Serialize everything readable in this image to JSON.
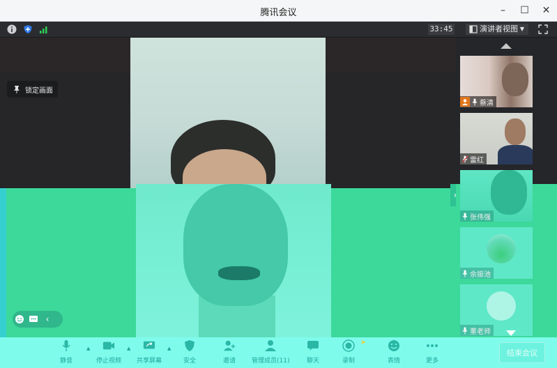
{
  "window": {
    "title": "腾讯会议"
  },
  "infobar": {
    "timer": "33:45",
    "view_mode": "演讲者视图"
  },
  "stage": {
    "pin_label": "锁定画面"
  },
  "participants": [
    {
      "name": "蔡清"
    },
    {
      "name": "雷红"
    },
    {
      "name": "张伟强"
    },
    {
      "name": "余振池"
    },
    {
      "name": "董老师"
    }
  ],
  "toolbar": {
    "items": [
      {
        "label": "静音"
      },
      {
        "label": "停止视频"
      },
      {
        "label": "共享屏幕"
      },
      {
        "label": "安全"
      },
      {
        "label": "邀请"
      },
      {
        "label": "管理成员(11)"
      },
      {
        "label": "聊天"
      },
      {
        "label": "录制"
      },
      {
        "label": "表情"
      },
      {
        "label": "更多"
      }
    ],
    "end_label": "结束会议"
  },
  "colors": {
    "accent_green": "#3cd99a",
    "toolbar_bg": "#7ffbec",
    "host_badge": "#e2771c"
  }
}
